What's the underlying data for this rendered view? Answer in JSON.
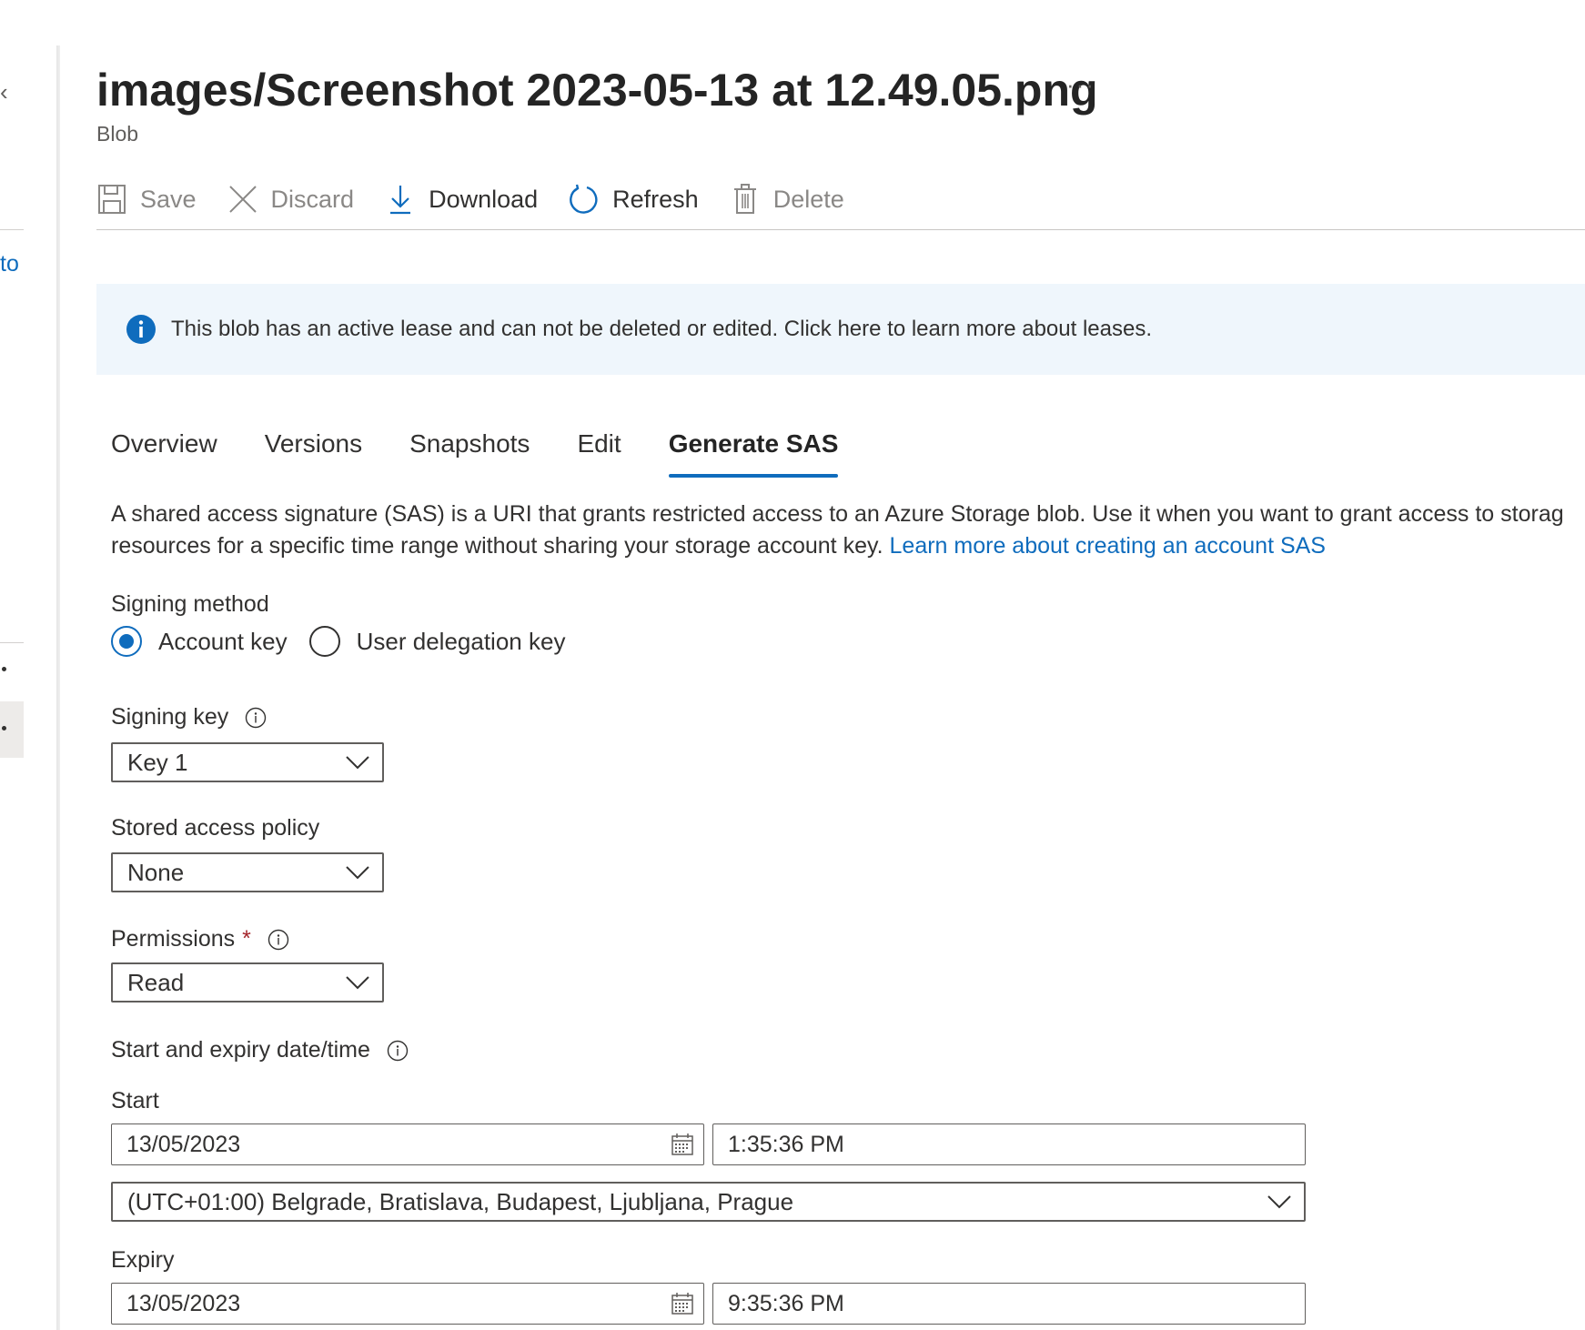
{
  "left": {
    "link_text": "to"
  },
  "header": {
    "title": "images/Screenshot 2023-05-13 at 12.49.05.png",
    "more": "···",
    "subtitle": "Blob"
  },
  "toolbar": {
    "save": "Save",
    "discard": "Discard",
    "download": "Download",
    "refresh": "Refresh",
    "delete": "Delete"
  },
  "banner": {
    "message": "This blob has an active lease and can not be deleted or edited. Click here to learn more about leases."
  },
  "tabs": [
    {
      "label": "Overview"
    },
    {
      "label": "Versions"
    },
    {
      "label": "Snapshots"
    },
    {
      "label": "Edit"
    },
    {
      "label": "Generate SAS",
      "active": true
    }
  ],
  "description": {
    "line1": "A shared access signature (SAS) is a URI that grants restricted access to an Azure Storage blob. Use it when you want to grant access to storag",
    "line2": "resources for a specific time range without sharing your storage account key. ",
    "link": "Learn more about creating an account SAS"
  },
  "form": {
    "signing_method_label": "Signing method",
    "signing_method_options": [
      "Account key",
      "User delegation key"
    ],
    "signing_method_selected": "Account key",
    "signing_key_label": "Signing key",
    "signing_key_value": "Key 1",
    "stored_policy_label": "Stored access policy",
    "stored_policy_value": "None",
    "permissions_label": "Permissions",
    "permissions_required": "*",
    "permissions_value": "Read",
    "dates_label": "Start and expiry date/time",
    "start_label": "Start",
    "start_date": "13/05/2023",
    "start_time": "1:35:36 PM",
    "timezone": "(UTC+01:00) Belgrade, Bratislava, Budapest, Ljubljana, Prague",
    "expiry_label": "Expiry",
    "expiry_date": "13/05/2023",
    "expiry_time": "9:35:36 PM"
  },
  "colors": {
    "accent": "#0f6cbd",
    "banner_bg": "#eff6fc",
    "required": "#a4262c"
  }
}
